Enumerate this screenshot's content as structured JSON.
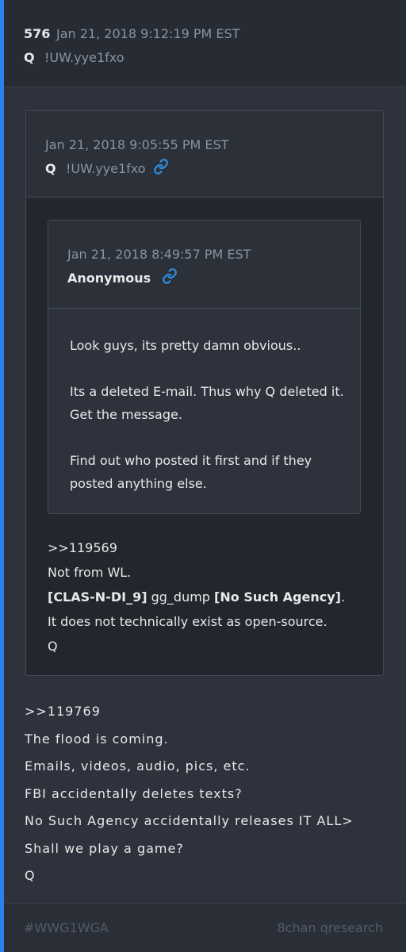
{
  "post": {
    "number": "576",
    "date": "Jan 21, 2018 9:12:19 PM EST",
    "author": "Q",
    "tripcode": "!UW.yye1fxo",
    "body_lines": [
      ">>119769",
      "The flood is coming.",
      "Emails, videos, audio, pics, etc.",
      "FBI accidentally deletes texts?",
      "No Such Agency accidentally releases IT ALL>",
      "Shall we play a game?",
      "Q"
    ]
  },
  "quoted_post": {
    "date": "Jan 21, 2018 9:05:55 PM EST",
    "author": "Q",
    "tripcode": "!UW.yye1fxo",
    "link_icon": "link-icon",
    "body": {
      "ref": ">>119569",
      "line1": "Not from WL.",
      "bold1": "[CLAS-N-DI_9]",
      "mid": " gg_dump ",
      "bold2": "[No Such Agency]",
      "end": ".",
      "line3": "It does not technically exist as open-source.",
      "sign": "Q"
    }
  },
  "nested_quote": {
    "date": "Jan 21, 2018 8:49:57 PM EST",
    "author": "Anonymous",
    "link_icon": "link-icon",
    "paragraphs": [
      "Look guys, its pretty damn obvious..",
      "Its a deleted E-mail. Thus why Q deleted it. Get the message.",
      "Find out who posted it first and if they posted anything else."
    ]
  },
  "footer": {
    "tag": "#WWG1WGA",
    "source": "8chan qresearch"
  },
  "colors": {
    "accent": "#2f7ff0",
    "link": "#2f8fe0"
  }
}
